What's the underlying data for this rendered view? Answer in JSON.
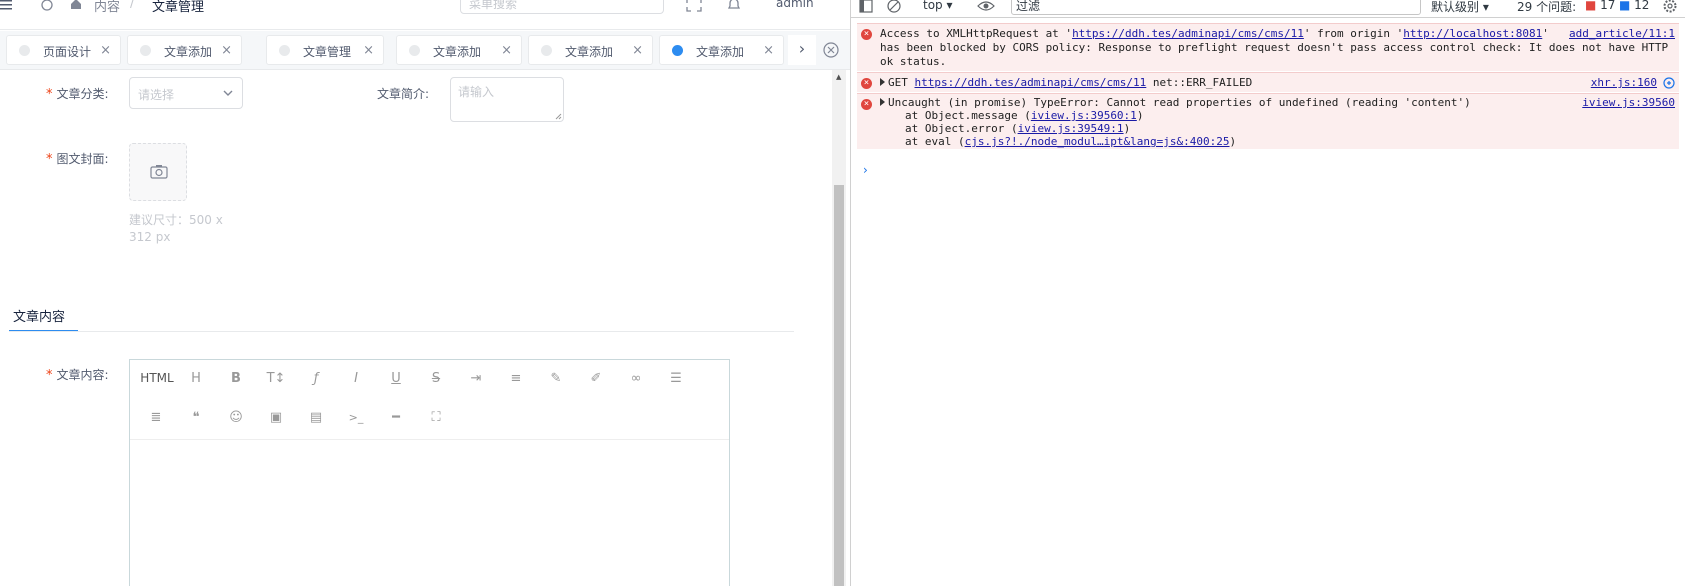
{
  "topbar": {
    "breadcrumb_home": "内容",
    "breadcrumb_separator": "/",
    "breadcrumb_current": "文章管理",
    "search_placeholder": "菜单搜索",
    "user": "admin"
  },
  "tabs": [
    {
      "label": "页面设计",
      "active": false
    },
    {
      "label": "文章添加",
      "active": false
    },
    {
      "label": "文章管理",
      "active": false
    },
    {
      "label": "文章添加",
      "active": false
    },
    {
      "label": "文章添加",
      "active": false
    },
    {
      "label": "文章添加",
      "active": true
    }
  ],
  "tab_close_glyph": "×",
  "tab_next_glyph": "›",
  "form": {
    "category_label": "文章分类:",
    "category_placeholder": "请选择",
    "summary_label": "文章简介:",
    "summary_placeholder": "请输入",
    "cover_label": "图文封面:",
    "cover_hint": "建议尺寸：500 x 312 px",
    "required_mark": "*",
    "section_tab": "文章内容",
    "content_label": "文章内容:"
  },
  "editor_toolbar": {
    "row1": [
      "HTML",
      "heading-icon",
      "bold-icon",
      "font-size-icon",
      "font-family-icon",
      "italic-icon",
      "underline-icon",
      "strikethrough-icon",
      "indent-icon",
      "line-height-icon",
      "fore-color-icon",
      "back-color-icon",
      "link-icon",
      "list-icon"
    ],
    "row2": [
      "justify-icon",
      "quote-icon",
      "emoticon-icon",
      "image-icon",
      "video-icon",
      "code-icon",
      "splitline-icon",
      "fullscreen-icon"
    ],
    "html_label": "HTML"
  },
  "devtools": {
    "context": "top",
    "filter": "过滤",
    "levels": "默认级别",
    "issues": "29 个问题:",
    "error_count": "17",
    "info_count": "12",
    "messages": [
      {
        "line1_pre": "Access to XMLHttpRequest at '",
        "line1_url": "https://ddh.tes/adminapi/cms/cms/11",
        "line1_mid": "' from origin '",
        "line1_origin": "http://localhost:8081",
        "line1_post": "'",
        "line2": "has been blocked by CORS policy: Response to preflight request doesn't pass access control check: It does not have HTTP",
        "line3": "ok status.",
        "source": "add_article/11:1"
      },
      {
        "method": "GET",
        "url": "https://ddh.tes/adminapi/cms/cms/11",
        "status": "net::ERR_FAILED",
        "source": "xhr.js:160"
      },
      {
        "line1": "Uncaught (in promise) TypeError: Cannot read properties of undefined (reading 'content')",
        "stack": [
          {
            "pre": "at Object.message (",
            "link": "iview.js:39560:1",
            "post": ")"
          },
          {
            "pre": "at Object.error (",
            "link": "iview.js:39549:1",
            "post": ")"
          },
          {
            "pre": "at eval (",
            "link": "cjs.js?!./node_modul…ipt&lang=js&:400:25",
            "post": ")"
          }
        ],
        "source": "iview.js:39560"
      }
    ],
    "prompt": "›"
  }
}
